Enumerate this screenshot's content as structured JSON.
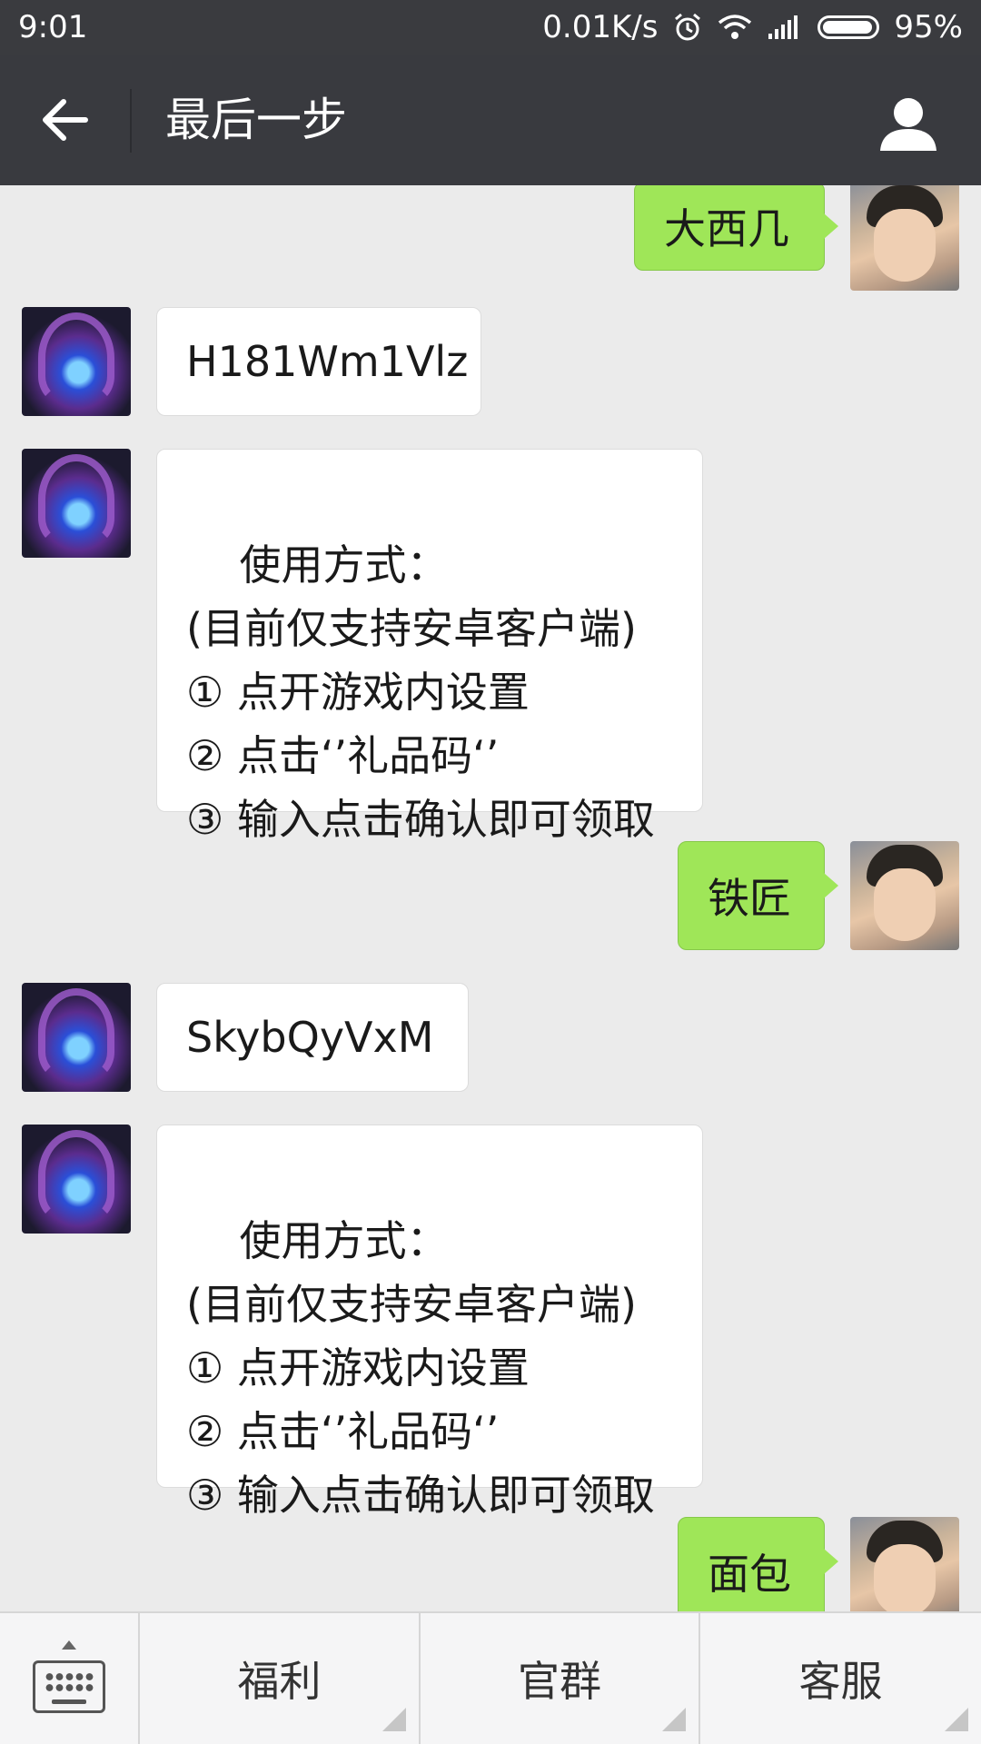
{
  "status_bar": {
    "time": "9:01",
    "net_speed": "0.01K/s",
    "battery": "95%",
    "battery_level": 0.95
  },
  "header": {
    "title": "最后一步"
  },
  "messages": [
    {
      "side": "out",
      "text": "大西几"
    },
    {
      "side": "in",
      "text": "H181Wm1Vlz"
    },
    {
      "side": "in",
      "text": "使用方式：\n(目前仅支持安卓客户端)\n① 点开游戏内设置\n② 点击‘’礼品码‘’\n③ 输入点击确认即可领取"
    },
    {
      "side": "out",
      "text": "铁匠"
    },
    {
      "side": "in",
      "text": "SkybQyVxM"
    },
    {
      "side": "in",
      "text": "使用方式：\n(目前仅支持安卓客户端)\n① 点开游戏内设置\n② 点击‘’礼品码‘’\n③ 输入点击确认即可领取"
    },
    {
      "side": "out",
      "text": "面包"
    }
  ],
  "menu": {
    "items": [
      "福利",
      "官群",
      "客服"
    ]
  },
  "icons": {
    "status": [
      "alarm-icon",
      "wifi-icon",
      "signal-icon",
      "battery-icon"
    ],
    "header": [
      "back-arrow-icon",
      "profile-icon"
    ],
    "footer": [
      "keyboard-icon"
    ]
  },
  "colors": {
    "titlebar": "#393a3f",
    "outgoing_bubble": "#9fe658",
    "incoming_bubble": "#ffffff",
    "background": "#ebebeb"
  }
}
